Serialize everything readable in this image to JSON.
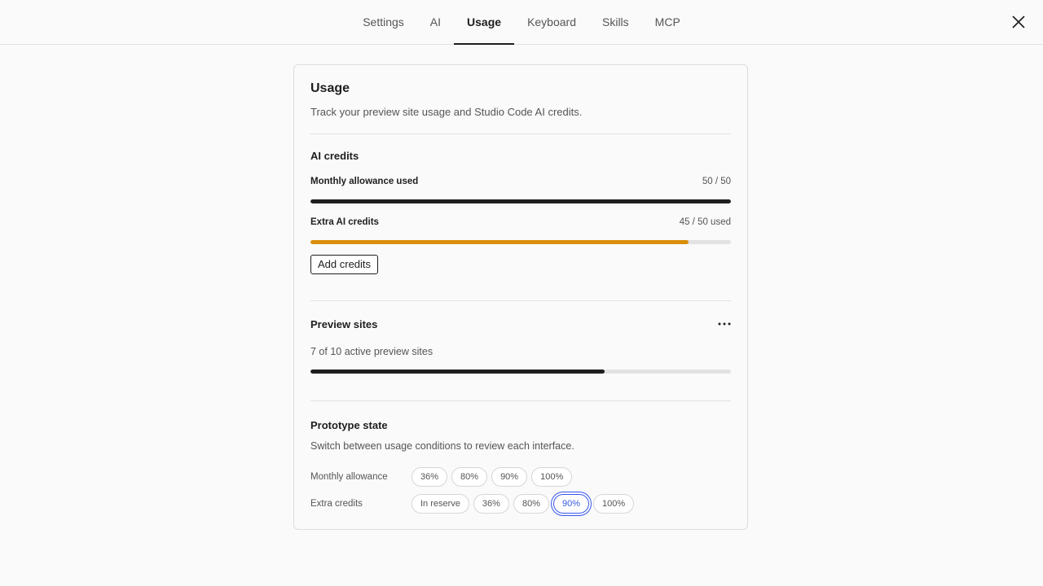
{
  "tabs": [
    {
      "label": "Settings",
      "active": false
    },
    {
      "label": "AI",
      "active": false
    },
    {
      "label": "Usage",
      "active": true
    },
    {
      "label": "Keyboard",
      "active": false
    },
    {
      "label": "Skills",
      "active": false
    },
    {
      "label": "MCP",
      "active": false
    }
  ],
  "close_icon": "close-icon",
  "card": {
    "title": "Usage",
    "description": "Track your preview site usage and Studio Code AI credits."
  },
  "ai_credits": {
    "title": "AI credits",
    "monthly": {
      "label": "Monthly allowance used",
      "value": "50 / 50",
      "fraction": 1.0,
      "color": "#1e1e1e"
    },
    "extra": {
      "label": "Extra AI credits",
      "value": "45 / 50 used",
      "fraction": 0.9,
      "color": "#d98e0b"
    },
    "add_button": "Add credits"
  },
  "preview_sites": {
    "title": "Preview sites",
    "more_icon": "more-horizontal-icon",
    "summary": "7 of 10 active preview sites",
    "fraction": 0.7,
    "color": "#1e1e1e"
  },
  "prototype": {
    "title": "Prototype state",
    "description": "Switch between usage conditions to review each interface.",
    "monthly": {
      "label": "Monthly allowance",
      "options": [
        "36%",
        "80%",
        "90%",
        "100%"
      ],
      "selected": null
    },
    "extra": {
      "label": "Extra credits",
      "options": [
        "In reserve",
        "36%",
        "80%",
        "90%",
        "100%"
      ],
      "selected": "90%"
    }
  },
  "colors": {
    "accent": "#3858e9",
    "warning": "#d98e0b",
    "track": "#e2e2e2"
  }
}
